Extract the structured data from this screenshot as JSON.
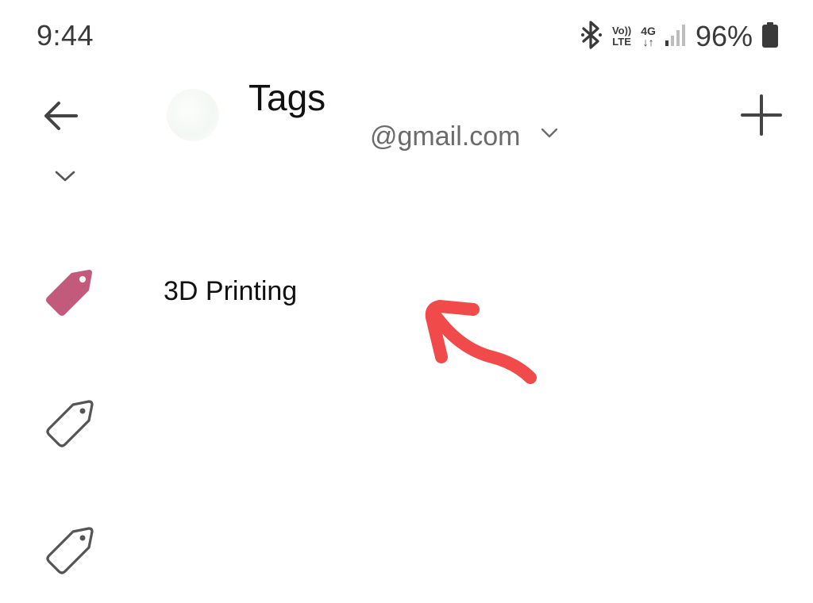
{
  "status_bar": {
    "time": "9:44",
    "volte_top": "Vo))",
    "volte_bottom": "LTE",
    "network_top": "4G",
    "network_bottom": "↓↑",
    "battery_percent": "96%",
    "icons": [
      "bluetooth-icon",
      "volte-icon",
      "4g-icon",
      "signal-icon",
      "battery-icon"
    ]
  },
  "app_bar": {
    "title": "Tags",
    "account_email": "@gmail.com",
    "back_icon": "arrow-left-icon",
    "add_icon": "plus-icon",
    "account_chevron_icon": "chevron-down-icon"
  },
  "tags": [
    {
      "label": "3D Printing",
      "icon": "tag-filled-icon",
      "color": "#c25a7c"
    },
    {
      "label": "",
      "icon": "tag-outline-icon",
      "color": "#555555"
    },
    {
      "label": "",
      "icon": "tag-outline-icon",
      "color": "#555555"
    }
  ],
  "colors": {
    "icon_gray": "#444444",
    "secondary_text": "#6b6b6b",
    "tag_accent": "#c25a7c",
    "annotation": "#f14a4a"
  }
}
